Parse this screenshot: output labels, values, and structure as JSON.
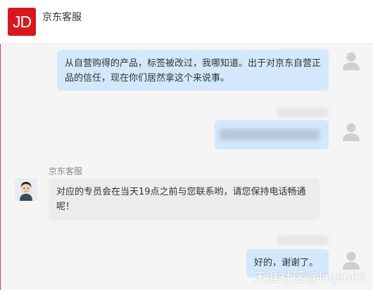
{
  "header": {
    "logo_text": "JD",
    "title": "京东客服"
  },
  "colors": {
    "brand_red": "#d7191f",
    "bubble_user": "#d3e8fc",
    "bubble_agent": "#ececec",
    "left_accent": "#e3394c"
  },
  "messages": [
    {
      "from": "user",
      "text": "从自营购得的产品，标签被改过，我哪知道。出于对京东自营正品的信任，现在你们居然拿这个来说事。"
    },
    {
      "from": "user",
      "text": ""
    },
    {
      "from": "agent",
      "sender": "京东客服",
      "text": "对应的专员会在当天19点之前与您联系哟，请您保持电话畅通呢！"
    },
    {
      "from": "user",
      "text": "好的，谢谢了。"
    }
  ],
  "watermark": "天涯社区@lcq5066",
  "icons": {
    "user_avatar": "user-avatar-icon",
    "agent_avatar": "agent-avatar-icon"
  }
}
